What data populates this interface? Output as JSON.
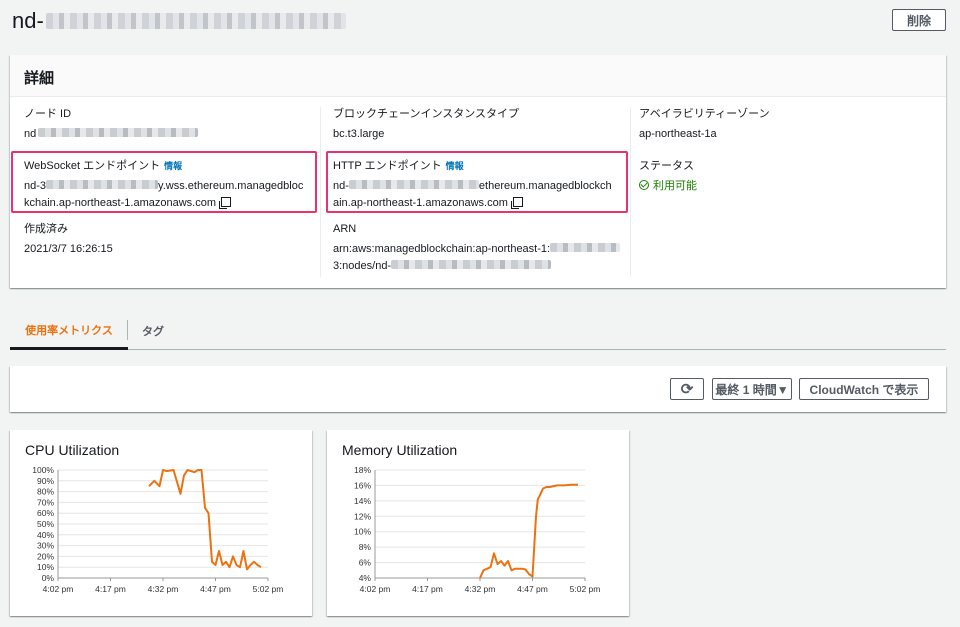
{
  "page": {
    "title_prefix": "nd-",
    "delete_label": "削除"
  },
  "details": {
    "header": "詳細",
    "node_id_label": "ノード ID",
    "node_id_value": "nd",
    "instance_type_label": "ブロックチェーンインスタンスタイプ",
    "instance_type_value": "bc.t3.large",
    "az_label": "アベイラビリティーゾーン",
    "az_value": "ap-northeast-1a",
    "ws_label": "WebSocket エンドポイント",
    "ws_info": "情報",
    "ws_line1_prefix": "nd-3",
    "ws_line1_suffix": "y.wss.ethereum.managedbloc",
    "ws_line2": "kchain.ap-northeast-1.amazonaws.com",
    "http_label": "HTTP エンドポイント",
    "http_info": "情報",
    "http_line1_prefix": "nd-",
    "http_line1_suffix": "ethereum.managedblockch",
    "http_line2": "ain.ap-northeast-1.amazonaws.com",
    "status_label": "ステータス",
    "status_value": "利用可能",
    "created_label": "作成済み",
    "created_value": "2021/3/7 16:26:15",
    "arn_label": "ARN",
    "arn_line1": "arn:aws:managedblockchain:ap-northeast-1:",
    "arn_line2_prefix": "3:nodes/nd-",
    "colors": {
      "status": "#1d8102",
      "info_link": "#0073bb",
      "highlight": "#e8336d"
    }
  },
  "tabs": [
    {
      "label": "使用率メトリクス",
      "active": true
    },
    {
      "label": "タグ",
      "active": false
    }
  ],
  "toolbar": {
    "refresh_icon": "refresh-icon",
    "refresh_glyph": "⟳",
    "range_label": "最終 1 時間▼",
    "cloudwatch_label": "CloudWatch で表示"
  },
  "chart_data": [
    {
      "type": "line",
      "title": "CPU Utilization",
      "ylim": [
        0,
        100
      ],
      "y_ticks": [
        "100%",
        "90%",
        "80%",
        "70%",
        "60%",
        "50%",
        "40%",
        "30%",
        "20%",
        "10%",
        "0%"
      ],
      "x_ticks": [
        "4:02 pm",
        "4:17 pm",
        "4:32 pm",
        "4:47 pm",
        "5:02 pm"
      ],
      "x_tick_minutes": [
        0,
        15,
        30,
        45,
        60
      ],
      "color": "#ec7211",
      "series": [
        {
          "x": [
            26,
            27.5,
            29,
            30,
            31,
            33,
            35,
            36,
            37,
            39,
            40,
            41,
            42,
            43,
            44,
            45,
            46,
            47,
            48,
            49,
            50,
            51,
            52,
            53,
            54,
            55,
            56,
            57,
            58
          ],
          "values": [
            85,
            90,
            85,
            100,
            99,
            100,
            78,
            95,
            100,
            98,
            100,
            100,
            65,
            60,
            15,
            12,
            25,
            12,
            15,
            10,
            20,
            12,
            10,
            25,
            8,
            12,
            15,
            12,
            10
          ]
        }
      ]
    },
    {
      "type": "line",
      "title": "Memory Utilization",
      "ylim": [
        4,
        18
      ],
      "y_ticks": [
        "18%",
        "16%",
        "14%",
        "12%",
        "10%",
        "8%",
        "6%",
        "4%"
      ],
      "x_ticks": [
        "4:02 pm",
        "4:17 pm",
        "4:32 pm",
        "4:47 pm",
        "5:02 pm"
      ],
      "x_tick_minutes": [
        0,
        15,
        30,
        45,
        60
      ],
      "color": "#ec7211",
      "series": [
        {
          "x": [
            30,
            31,
            33,
            34,
            35,
            36,
            37,
            38,
            39,
            40,
            42,
            43,
            44,
            45,
            46,
            46.5,
            47,
            48,
            49,
            50,
            52,
            54,
            56,
            58
          ],
          "values": [
            4.0,
            5.0,
            5.4,
            7.2,
            5.8,
            6.2,
            5.6,
            6.2,
            5.0,
            5.2,
            5.2,
            5.1,
            4.5,
            4.2,
            12.0,
            14.2,
            14.6,
            15.6,
            15.8,
            15.8,
            16.0,
            16.0,
            16.1,
            16.1
          ]
        }
      ]
    }
  ]
}
